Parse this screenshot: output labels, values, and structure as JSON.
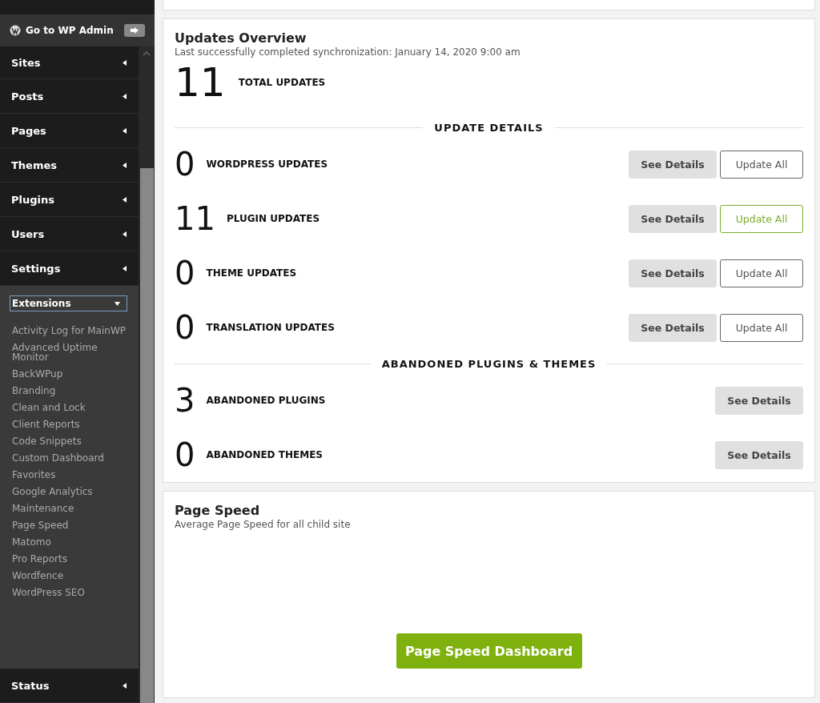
{
  "sidebar": {
    "admin_link": "Go to WP Admin",
    "menu": [
      {
        "label": "Sites"
      },
      {
        "label": "Posts"
      },
      {
        "label": "Pages"
      },
      {
        "label": "Themes"
      },
      {
        "label": "Plugins"
      },
      {
        "label": "Users"
      },
      {
        "label": "Settings"
      }
    ],
    "extensions_select": "Extensions",
    "extensions": [
      "Activity Log for MainWP",
      "Advanced Uptime Monitor",
      "BackWPup",
      "Branding",
      "Clean and Lock",
      "Client Reports",
      "Code Snippets",
      "Custom Dashboard",
      "Favorites",
      "Google Analytics",
      "Maintenance",
      "Page Speed",
      "Matomo",
      "Pro Reports",
      "Wordfence",
      "WordPress SEO"
    ],
    "bottom_menu": [
      {
        "label": "Status"
      }
    ]
  },
  "updates_overview": {
    "title": "Updates Overview",
    "subtitle": "Last successfully completed synchronization: January 14, 2020 9:00 am",
    "total": {
      "count": "11",
      "label": "TOTAL UPDATES"
    },
    "sections": [
      {
        "heading": "UPDATE DETAILS",
        "rows": [
          {
            "count": "0",
            "label": "WORDPRESS UPDATES",
            "details": "See Details",
            "update": "Update All",
            "highlighted": false
          },
          {
            "count": "11",
            "label": "PLUGIN UPDATES",
            "details": "See Details",
            "update": "Update All",
            "highlighted": true
          },
          {
            "count": "0",
            "label": "THEME UPDATES",
            "details": "See Details",
            "update": "Update All",
            "highlighted": false
          },
          {
            "count": "0",
            "label": "TRANSLATION UPDATES",
            "details": "See Details",
            "update": "Update All",
            "highlighted": false
          }
        ]
      },
      {
        "heading": "ABANDONED PLUGINS & THEMES",
        "rows": [
          {
            "count": "3",
            "label": "ABANDONED PLUGINS",
            "details": "See Details"
          },
          {
            "count": "0",
            "label": "ABANDONED THEMES",
            "details": "See Details"
          }
        ]
      }
    ]
  },
  "page_speed": {
    "title": "Page Speed",
    "subtitle": "Average Page Speed for all child site",
    "button": "Page Speed Dashboard"
  }
}
